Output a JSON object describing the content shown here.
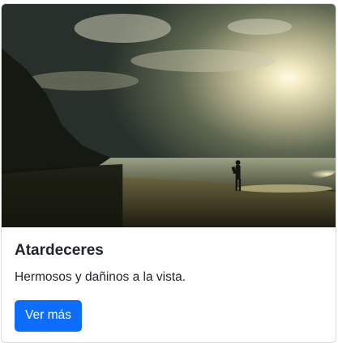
{
  "card": {
    "title": "Atardeceres",
    "text": "Hermosos y dañinos a la vista.",
    "button_label": "Ver más",
    "image_icon": "sunset-beach-photo",
    "accent_color": "#0d6efd"
  }
}
